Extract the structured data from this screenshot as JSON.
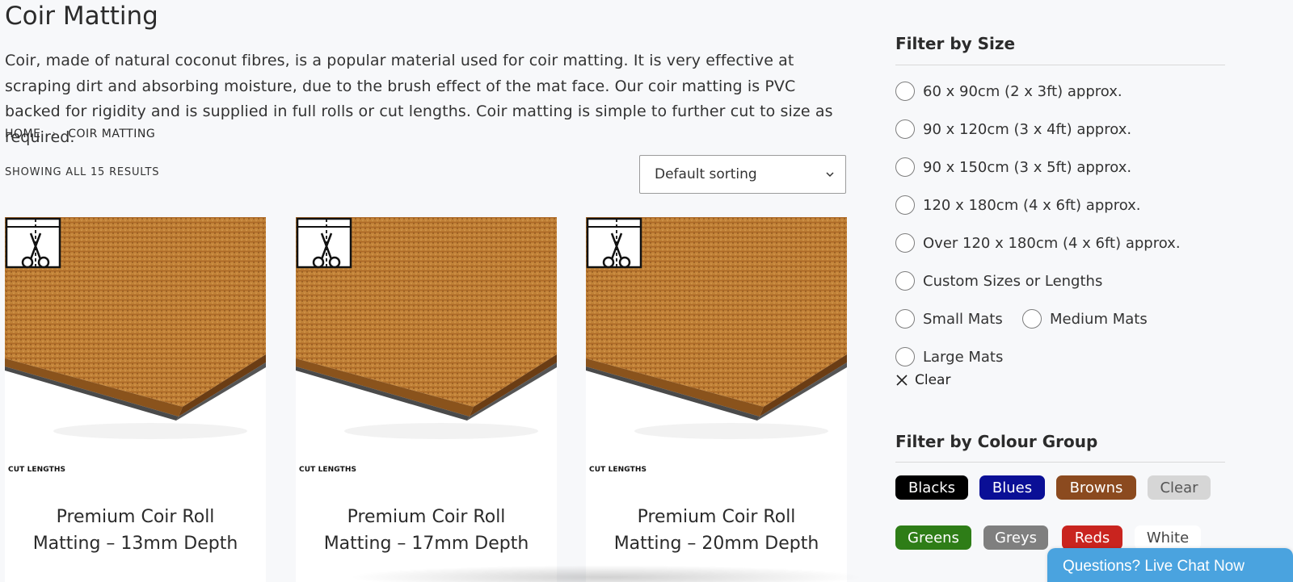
{
  "page": {
    "title": "Coir Matting",
    "intro": "Coir, made of natural coconut fibres, is a popular material used for coir matting. It is very effective at scraping dirt and absorbing moisture, due to the brush effect of the mat face. Our coir matting is PVC backed for rigidity and is supplied in full rolls or cut lengths. Coir matting is simple to further cut to size as required."
  },
  "breadcrumb": {
    "home": "HOME",
    "separator": "›",
    "current": "COIR MATTING"
  },
  "results": {
    "count_text": "SHOWING ALL 15 RESULTS"
  },
  "sorting": {
    "selected": "Default sorting"
  },
  "products": [
    {
      "title_line1": "Premium Coir Roll",
      "title_line2": "Matting – 13mm Depth",
      "badge": "CUT LENGTHS"
    },
    {
      "title_line1": "Premium Coir Roll",
      "title_line2": "Matting – 17mm Depth",
      "badge": "CUT LENGTHS"
    },
    {
      "title_line1": "Premium Coir Roll",
      "title_line2": "Matting – 20mm Depth",
      "badge": "CUT LENGTHS"
    }
  ],
  "filter_size": {
    "title": "Filter by Size",
    "options": [
      "60 x 90cm (2 x 3ft) approx.",
      "90 x 120cm (3 x 4ft) approx.",
      "90 x 150cm (3 x 5ft) approx.",
      "120 x 180cm (4 x 6ft) approx.",
      "Over 120 x 180cm (4 x 6ft) approx.",
      "Custom Sizes or Lengths",
      "Small Mats",
      "Medium Mats",
      "Large Mats"
    ],
    "clear_label": "Clear"
  },
  "filter_colour": {
    "title": "Filter by Colour Group",
    "swatches": [
      {
        "label": "Blacks",
        "bg": "#000000",
        "fg": "#ffffff"
      },
      {
        "label": "Blues",
        "bg": "#0a0f96",
        "fg": "#ffffff"
      },
      {
        "label": "Browns",
        "bg": "#8b4a1f",
        "fg": "#ffffff"
      },
      {
        "label": "Clear",
        "bg": "#d6d6d6",
        "fg": "#555555"
      },
      {
        "label": "Greens",
        "bg": "#2e7d17",
        "fg": "#ffffff"
      },
      {
        "label": "Greys",
        "bg": "#7f7f7f",
        "fg": "#ffffff"
      },
      {
        "label": "Reds",
        "bg": "#c9241f",
        "fg": "#ffffff"
      },
      {
        "label": "White",
        "bg": "#ffffff",
        "fg": "#444444"
      }
    ]
  },
  "chat": {
    "label": "Questions? Live Chat Now"
  },
  "colors": {
    "coir_light": "#c98a3e",
    "coir_dark": "#8a531c",
    "chat_blue": "#4aa3df"
  }
}
